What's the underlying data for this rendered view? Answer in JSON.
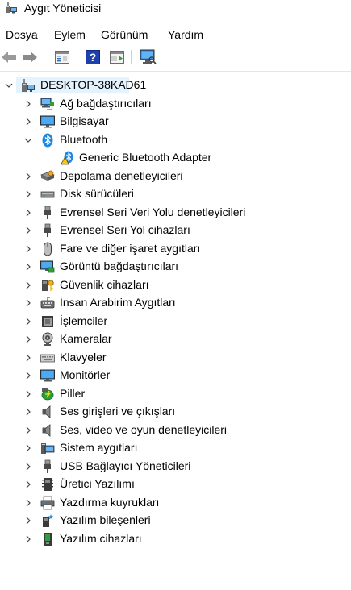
{
  "window": {
    "title": "Aygıt Yöneticisi"
  },
  "menu": [
    "Dosya",
    "Eylem",
    "Görünüm",
    "Yardım"
  ],
  "toolbar": {
    "buttons": [
      "back-arrow-icon",
      "forward-arrow-icon",
      "properties-panel-icon",
      "help-icon",
      "action-pane-icon",
      "scan-hardware-icon"
    ]
  },
  "tree": {
    "root": {
      "label": "DESKTOP-38KAD61",
      "icon": "computer-icon",
      "expanded": true
    },
    "categories": [
      {
        "label": "Ağ bağdaştırıcıları",
        "icon": "network-adapter-icon",
        "expanded": false
      },
      {
        "label": "Bilgisayar",
        "icon": "monitor-icon",
        "expanded": false
      },
      {
        "label": "Bluetooth",
        "icon": "bluetooth-icon",
        "expanded": true,
        "children": [
          {
            "label": "Generic Bluetooth Adapter",
            "icon": "warning-bluetooth-icon"
          }
        ]
      },
      {
        "label": "Depolama denetleyicileri",
        "icon": "storage-controller-icon",
        "expanded": false
      },
      {
        "label": "Disk sürücüleri",
        "icon": "disk-drive-icon",
        "expanded": false
      },
      {
        "label": "Evrensel Seri Veri Yolu denetleyicileri",
        "icon": "usb-plug-icon",
        "expanded": false
      },
      {
        "label": "Evrensel Seri Yol cihazları",
        "icon": "usb-plug-icon",
        "expanded": false
      },
      {
        "label": "Fare ve diğer işaret aygıtları",
        "icon": "mouse-icon",
        "expanded": false
      },
      {
        "label": "Görüntü bağdaştırıcıları",
        "icon": "display-adapter-icon",
        "expanded": false
      },
      {
        "label": "Güvenlik cihazları",
        "icon": "security-key-icon",
        "expanded": false
      },
      {
        "label": "İnsan Arabirim Aygıtları",
        "icon": "hid-icon",
        "expanded": false
      },
      {
        "label": "İşlemciler",
        "icon": "processor-icon",
        "expanded": false
      },
      {
        "label": "Kameralar",
        "icon": "camera-icon",
        "expanded": false
      },
      {
        "label": "Klavyeler",
        "icon": "keyboard-icon",
        "expanded": false
      },
      {
        "label": "Monitörler",
        "icon": "monitor-icon",
        "expanded": false
      },
      {
        "label": "Piller",
        "icon": "battery-icon",
        "expanded": false
      },
      {
        "label": "Ses girişleri ve çıkışları",
        "icon": "speaker-icon",
        "expanded": false
      },
      {
        "label": "Ses, video ve oyun denetleyicileri",
        "icon": "speaker-icon",
        "expanded": false
      },
      {
        "label": "Sistem aygıtları",
        "icon": "system-devices-icon",
        "expanded": false
      },
      {
        "label": "USB Bağlayıcı Yöneticileri",
        "icon": "usb-plug-icon",
        "expanded": false
      },
      {
        "label": "Üretici Yazılımı",
        "icon": "firmware-icon",
        "expanded": false
      },
      {
        "label": "Yazdırma kuyrukları",
        "icon": "printer-icon",
        "expanded": false
      },
      {
        "label": "Yazılım bileşenleri",
        "icon": "software-component-icon",
        "expanded": false
      },
      {
        "label": "Yazılım cihazları",
        "icon": "software-device-icon",
        "expanded": false
      }
    ]
  },
  "colors": {
    "selection": "#e5f3ff",
    "accent_blue": "#1e88e5",
    "warning_yellow": "#f5c518"
  }
}
